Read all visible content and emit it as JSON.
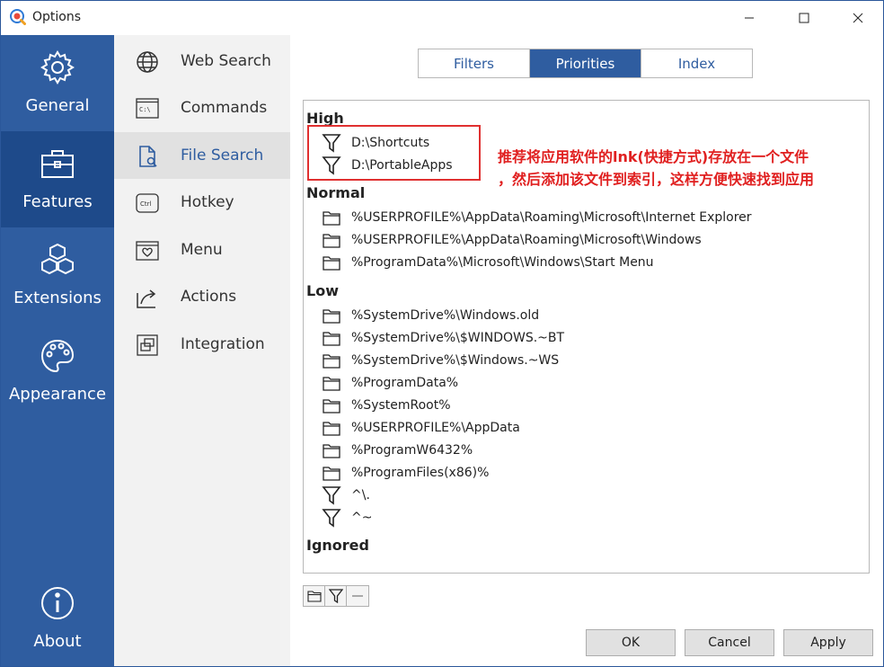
{
  "window": {
    "title": "Options"
  },
  "leftnav": {
    "items": [
      {
        "label": "General",
        "icon": "gear-icon"
      },
      {
        "label": "Features",
        "icon": "toolbox-icon"
      },
      {
        "label": "Extensions",
        "icon": "cubes-icon"
      },
      {
        "label": "Appearance",
        "icon": "palette-icon"
      },
      {
        "label": "About",
        "icon": "info-icon"
      }
    ],
    "active": "Features"
  },
  "subnav": {
    "items": [
      {
        "label": "Web Search",
        "icon": "globe-icon"
      },
      {
        "label": "Commands",
        "icon": "terminal-icon",
        "icon_text": "C:\\"
      },
      {
        "label": "File Search",
        "icon": "file-search-icon"
      },
      {
        "label": "Hotkey",
        "icon": "keyboard-key-icon",
        "icon_text": "Ctrl"
      },
      {
        "label": "Menu",
        "icon": "menu-heart-icon"
      },
      {
        "label": "Actions",
        "icon": "share-arrow-icon"
      },
      {
        "label": "Integration",
        "icon": "integration-icon"
      }
    ],
    "active": "File Search"
  },
  "tabs": [
    {
      "label": "Filters"
    },
    {
      "label": "Priorities"
    },
    {
      "label": "Index"
    }
  ],
  "active_tab": "Priorities",
  "priorities": {
    "high": {
      "label": "High",
      "items": [
        {
          "type": "filter",
          "text": "D:\\Shortcuts"
        },
        {
          "type": "filter",
          "text": "D:\\PortableApps"
        }
      ]
    },
    "normal": {
      "label": "Normal",
      "items": [
        {
          "type": "folder",
          "text": "%USERPROFILE%\\AppData\\Roaming\\Microsoft\\Internet Explorer"
        },
        {
          "type": "folder",
          "text": "%USERPROFILE%\\AppData\\Roaming\\Microsoft\\Windows"
        },
        {
          "type": "folder",
          "text": "%ProgramData%\\Microsoft\\Windows\\Start Menu"
        }
      ]
    },
    "low": {
      "label": "Low",
      "items": [
        {
          "type": "folder",
          "text": "%SystemDrive%\\Windows.old"
        },
        {
          "type": "folder",
          "text": "%SystemDrive%\\$WINDOWS.~BT"
        },
        {
          "type": "folder",
          "text": "%SystemDrive%\\$Windows.~WS"
        },
        {
          "type": "folder",
          "text": "%ProgramData%"
        },
        {
          "type": "folder",
          "text": "%SystemRoot%"
        },
        {
          "type": "folder",
          "text": "%USERPROFILE%\\AppData"
        },
        {
          "type": "folder",
          "text": "%ProgramW6432%"
        },
        {
          "type": "folder",
          "text": "%ProgramFiles(x86)%"
        },
        {
          "type": "filter",
          "text": "^\\."
        },
        {
          "type": "filter",
          "text": "^~"
        }
      ]
    },
    "ignored": {
      "label": "Ignored",
      "items": []
    }
  },
  "annotation": {
    "line1": "推荐将应用软件的lnk(快捷方式)存放在一个文件",
    "line2": "，然后添加该文件到索引，这样方便快速找到应用"
  },
  "buttons": {
    "ok": "OK",
    "cancel": "Cancel",
    "apply": "Apply"
  },
  "colors": {
    "accent": "#2f5da0",
    "nav_active": "#1e4a8a",
    "annotation": "#e02020"
  }
}
